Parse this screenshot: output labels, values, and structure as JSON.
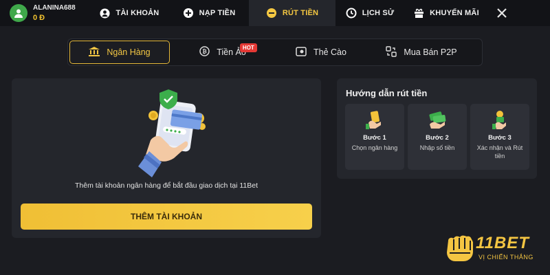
{
  "user": {
    "name": "ALANINA688",
    "balance": "0 Đ"
  },
  "nav": {
    "items": [
      {
        "label": "TÀI KHOẢN",
        "icon": "account-icon"
      },
      {
        "label": "NẠP TIỀN",
        "icon": "deposit-icon"
      },
      {
        "label": "RÚT TIỀN",
        "icon": "withdraw-icon",
        "active": true
      },
      {
        "label": "LỊCH SỬ",
        "icon": "history-icon"
      },
      {
        "label": "KHUYẾN MÃI",
        "icon": "promotion-icon"
      }
    ],
    "close_icon": "close-icon"
  },
  "methods": [
    {
      "label": "Ngân Hàng",
      "icon": "bank-icon",
      "active": true
    },
    {
      "label": "Tiền Ảo",
      "icon": "crypto-icon",
      "badge": "HOT"
    },
    {
      "label": "Thẻ Cào",
      "icon": "card-icon"
    },
    {
      "label": "Mua Bán P2P",
      "icon": "p2p-icon"
    }
  ],
  "bank": {
    "prompt": "Thêm tài khoản ngân hàng để bắt đầu giao dịch tại 11Bet",
    "add_button": "THÊM TÀI KHOẢN"
  },
  "guide": {
    "title": "Hướng dẫn rút tiền",
    "steps": [
      {
        "title": "Bước 1",
        "desc": "Chọn ngân hàng"
      },
      {
        "title": "Bước 2",
        "desc": "Nhập số tiền"
      },
      {
        "title": "Bước 3",
        "desc": "Xác nhận và Rút tiền"
      }
    ]
  },
  "brand": {
    "name": "11BET",
    "slogan": "VỊ CHIẾN THẮNG"
  },
  "colors": {
    "accent": "#f5c842",
    "hot": "#e53935",
    "bg": "#1b1c21",
    "panel": "#24262c"
  }
}
